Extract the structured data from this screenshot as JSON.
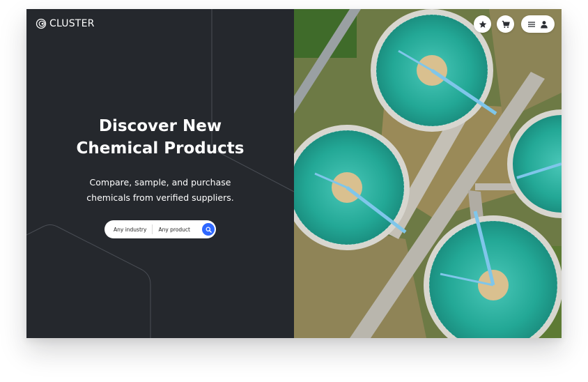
{
  "brand": {
    "name": "CLUSTER",
    "logo_icon": "cluster-logo-icon"
  },
  "hero": {
    "title_line1": "Discover New",
    "title_line2": "Chemical Products",
    "subtitle_line1": "Compare, sample, and purchase",
    "subtitle_line2": "chemicals from verified suppliers."
  },
  "search": {
    "industry_label": "Any industry",
    "product_label": "Any product",
    "button_icon": "search-icon"
  },
  "nav": {
    "favorites_icon": "star-icon",
    "cart_icon": "cart-icon",
    "menu_icon": "hamburger-menu-icon",
    "account_icon": "user-icon"
  },
  "colors": {
    "left_panel_bg": "#25282d",
    "accent_blue": "#2f68ff",
    "tank_water": "#2aa89a"
  }
}
